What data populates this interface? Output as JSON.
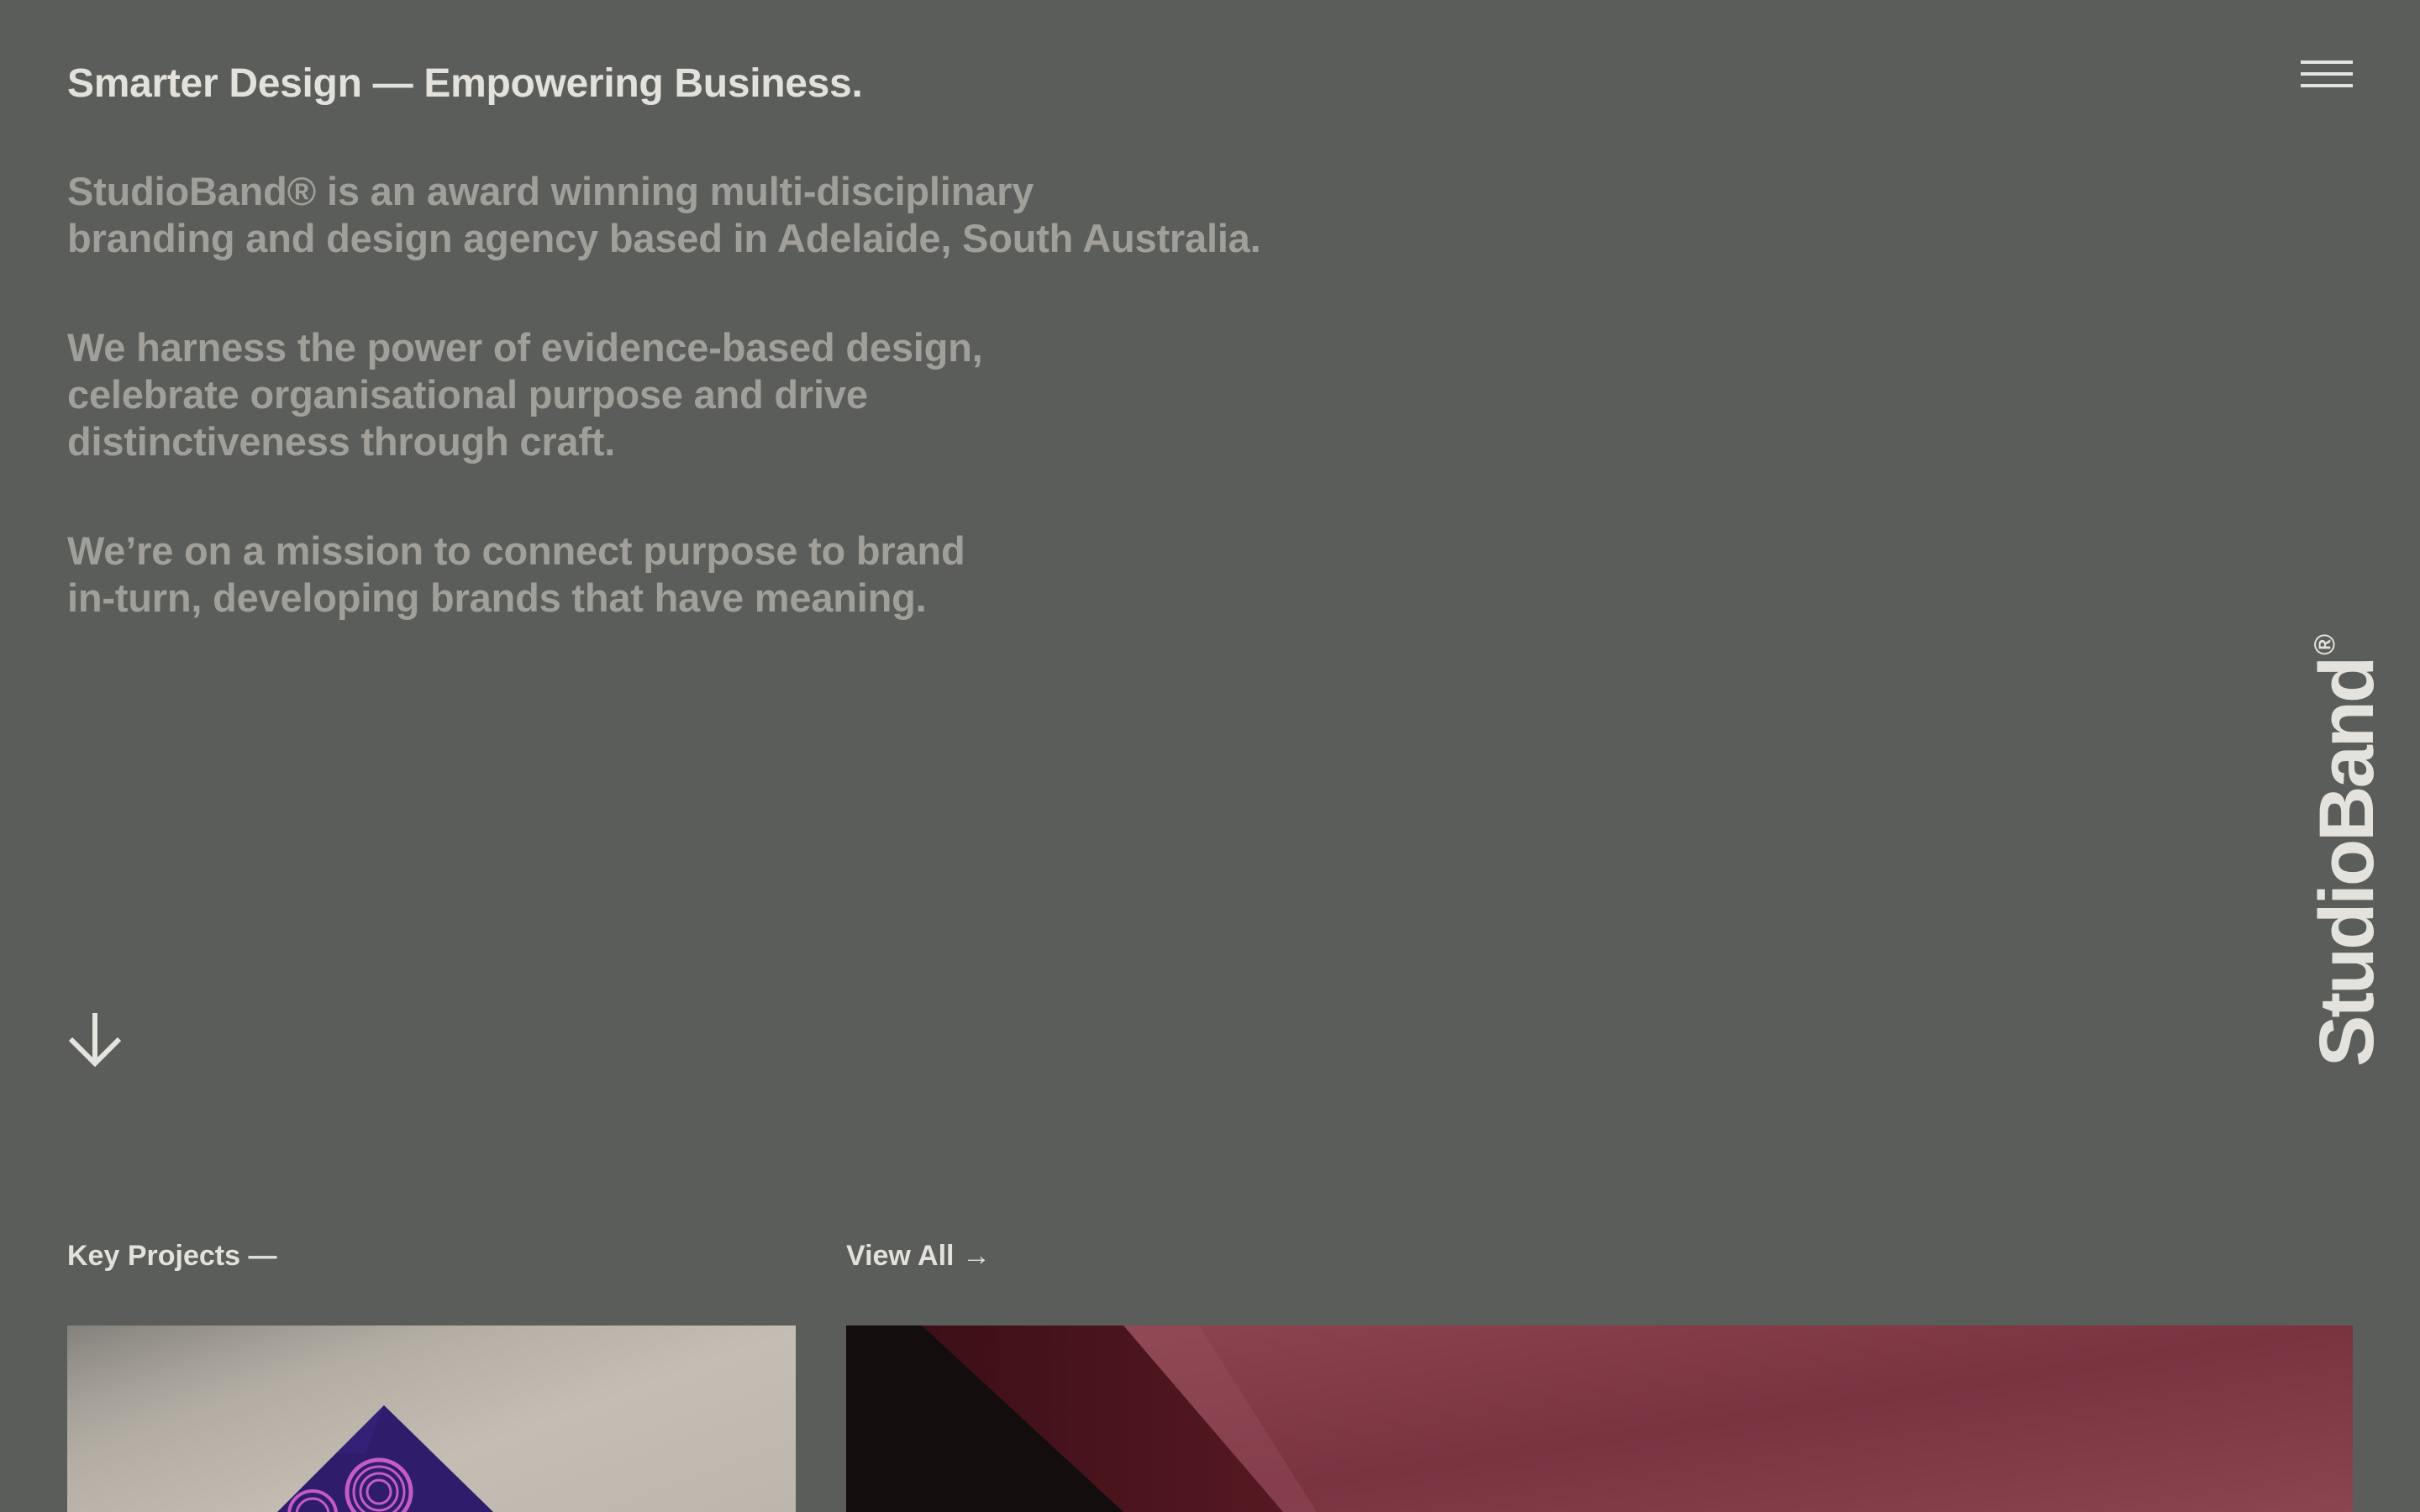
{
  "header": {
    "headline": "Smarter Design — Empowering Business.",
    "menu_icon": "hamburger-menu-icon"
  },
  "intro": {
    "paragraph_1": "StudioBand® is an award winning multi-disciplinary\nbranding and design agency based in Adelaide, South Australia.",
    "paragraph_2": "We harness the power of evidence-based design,\ncelebrate organisational purpose and drive\ndistinctiveness through craft.",
    "paragraph_3": "We’re on a mission to connect purpose to brand\nin-turn, developing brands that have meaning."
  },
  "scroll_icon": "arrow-down-icon",
  "logo": {
    "text": "StudioBand",
    "mark": "®"
  },
  "projects": {
    "section_title": "Key Projects —",
    "view_all_label": "View All →",
    "cards": [
      {
        "image": "purple-diamond-print-on-paper"
      },
      {
        "image": "crimson-paper-fold"
      }
    ]
  },
  "colors": {
    "background": "#5a5d59",
    "headline": "#e3e1dc",
    "body_text": "#a09f9a"
  }
}
